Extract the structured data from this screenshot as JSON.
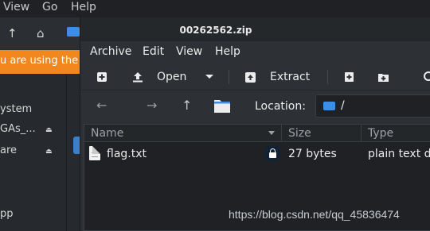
{
  "background_window": {
    "menu": [
      "View",
      "Go",
      "Help"
    ],
    "banner_text": "u are using the",
    "sidebar_items": [
      "ystem",
      "GAs_...",
      "are",
      "pp"
    ]
  },
  "archive_window": {
    "title": "00262562.zip",
    "menu": [
      "Archive",
      "Edit",
      "View",
      "Help"
    ],
    "toolbar": {
      "open_label": "Open",
      "extract_label": "Extract"
    },
    "location": {
      "label": "Location:",
      "path": "/"
    },
    "columns": [
      "Name",
      "Size",
      "Type"
    ],
    "files": [
      {
        "name": "flag.txt",
        "size": "27 bytes",
        "type": "plain text do...",
        "encrypted": true
      }
    ]
  },
  "watermark": "https://blog.csdn.net/qq_45836474",
  "colors": {
    "accent": "#3d8ee6",
    "banner": "#f2871d",
    "window_bg": "#2d3034",
    "list_bg": "#1f2124"
  }
}
